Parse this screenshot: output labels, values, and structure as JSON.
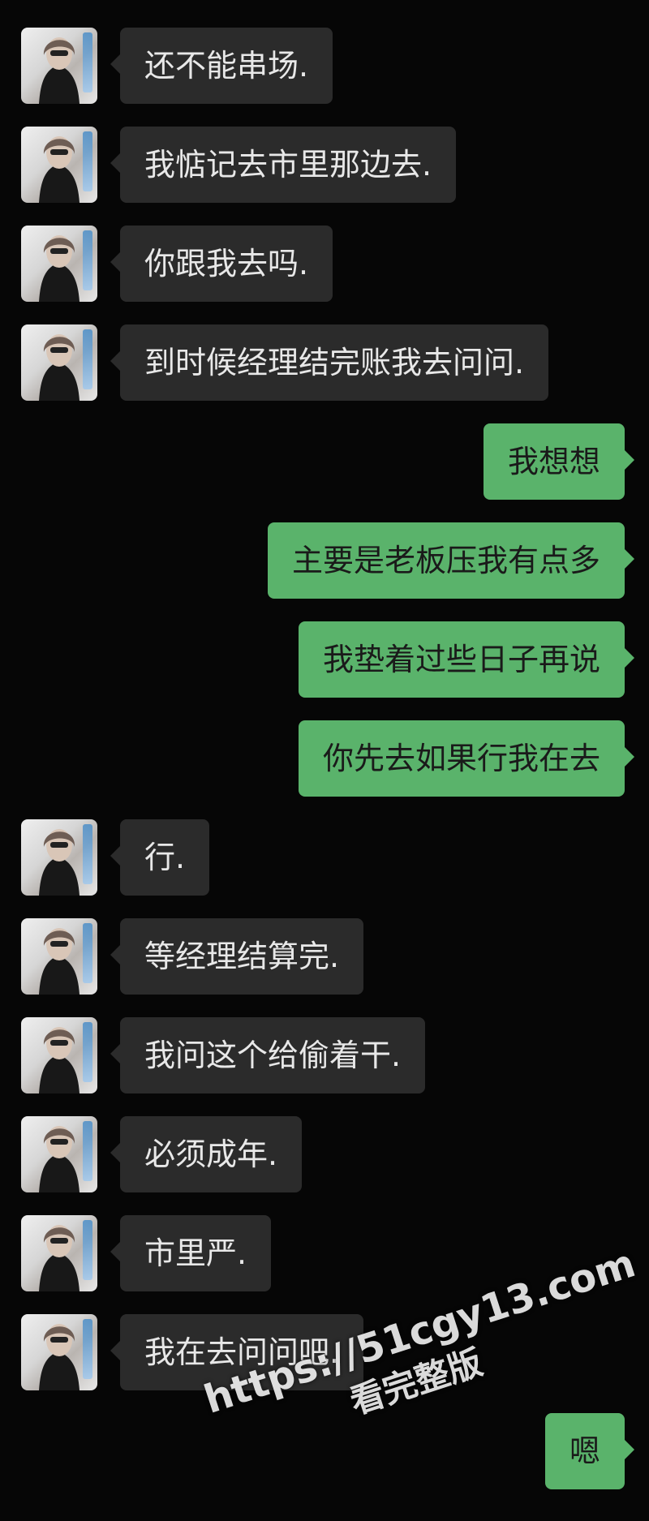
{
  "conversation": {
    "messages": [
      {
        "side": "left",
        "text": "还不能串场."
      },
      {
        "side": "left",
        "text": "我惦记去市里那边去."
      },
      {
        "side": "left",
        "text": "你跟我去吗."
      },
      {
        "side": "left",
        "text": "到时候经理结完账我去问问."
      },
      {
        "side": "right",
        "text": "我想想"
      },
      {
        "side": "right",
        "text": "主要是老板压我有点多"
      },
      {
        "side": "right",
        "text": "我垫着过些日子再说"
      },
      {
        "side": "right",
        "text": "你先去如果行我在去"
      },
      {
        "side": "left",
        "text": "行."
      },
      {
        "side": "left",
        "text": "等经理结算完."
      },
      {
        "side": "left",
        "text": "我问这个给偷着干."
      },
      {
        "side": "left",
        "text": "必须成年."
      },
      {
        "side": "left",
        "text": "市里严."
      },
      {
        "side": "left",
        "text": "我在去问问吧."
      },
      {
        "side": "right",
        "text": "嗯"
      }
    ]
  },
  "watermark": {
    "url": "https://51cgy13.com",
    "caption": "看完整版"
  }
}
